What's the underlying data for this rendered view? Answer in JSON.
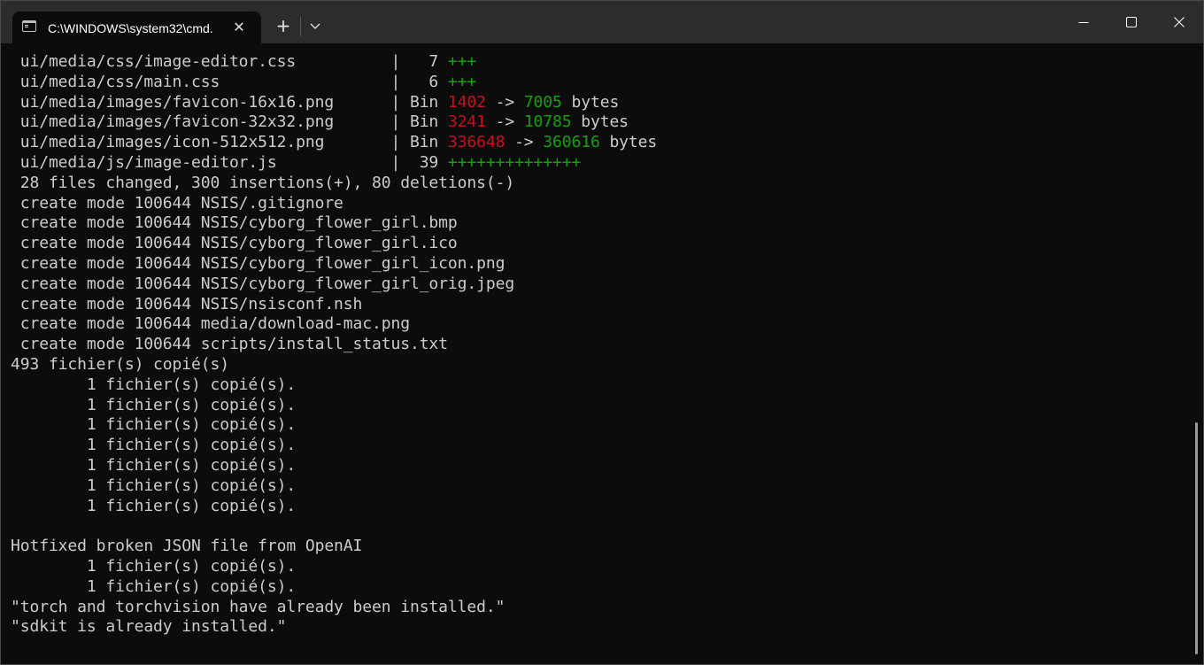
{
  "window": {
    "tab_title": "C:\\WINDOWS\\system32\\cmd.",
    "tab_close_glyph": "✕",
    "new_tab_glyph": "+"
  },
  "colors": {
    "background": "#0c0c0c",
    "titlebar": "#2c2c2c",
    "text": "#cccccc",
    "deletion_red": "#c50f1f",
    "insertion_green": "#13a10e"
  },
  "terminal": {
    "lines": [
      [
        {
          "t": " ui/media/css/image-editor.css          |   7 "
        },
        {
          "t": "+++",
          "c": "green"
        }
      ],
      [
        {
          "t": " ui/media/css/main.css                  |   6 "
        },
        {
          "t": "+++",
          "c": "green"
        }
      ],
      [
        {
          "t": " ui/media/images/favicon-16x16.png      | Bin "
        },
        {
          "t": "1402",
          "c": "red"
        },
        {
          "t": " -> "
        },
        {
          "t": "7005",
          "c": "green"
        },
        {
          "t": " bytes"
        }
      ],
      [
        {
          "t": " ui/media/images/favicon-32x32.png      | Bin "
        },
        {
          "t": "3241",
          "c": "red"
        },
        {
          "t": " -> "
        },
        {
          "t": "10785",
          "c": "green"
        },
        {
          "t": " bytes"
        }
      ],
      [
        {
          "t": " ui/media/images/icon-512x512.png       | Bin "
        },
        {
          "t": "336648",
          "c": "red"
        },
        {
          "t": " -> "
        },
        {
          "t": "360616",
          "c": "green"
        },
        {
          "t": " bytes"
        }
      ],
      [
        {
          "t": " ui/media/js/image-editor.js            |  39 "
        },
        {
          "t": "++++++++++++++",
          "c": "green"
        }
      ],
      [
        {
          "t": " 28 files changed, 300 insertions(+), 80 deletions(-)"
        }
      ],
      [
        {
          "t": " create mode 100644 NSIS/.gitignore"
        }
      ],
      [
        {
          "t": " create mode 100644 NSIS/cyborg_flower_girl.bmp"
        }
      ],
      [
        {
          "t": " create mode 100644 NSIS/cyborg_flower_girl.ico"
        }
      ],
      [
        {
          "t": " create mode 100644 NSIS/cyborg_flower_girl_icon.png"
        }
      ],
      [
        {
          "t": " create mode 100644 NSIS/cyborg_flower_girl_orig.jpeg"
        }
      ],
      [
        {
          "t": " create mode 100644 NSIS/nsisconf.nsh"
        }
      ],
      [
        {
          "t": " create mode 100644 media/download-mac.png"
        }
      ],
      [
        {
          "t": " create mode 100644 scripts/install_status.txt"
        }
      ],
      [
        {
          "t": "493 fichier(s) copié(s)"
        }
      ],
      [
        {
          "t": "        1 fichier(s) copié(s)."
        }
      ],
      [
        {
          "t": "        1 fichier(s) copié(s)."
        }
      ],
      [
        {
          "t": "        1 fichier(s) copié(s)."
        }
      ],
      [
        {
          "t": "        1 fichier(s) copié(s)."
        }
      ],
      [
        {
          "t": "        1 fichier(s) copié(s)."
        }
      ],
      [
        {
          "t": "        1 fichier(s) copié(s)."
        }
      ],
      [
        {
          "t": "        1 fichier(s) copié(s)."
        }
      ],
      [],
      [
        {
          "t": "Hotfixed broken JSON file from OpenAI"
        }
      ],
      [
        {
          "t": "        1 fichier(s) copié(s)."
        }
      ],
      [
        {
          "t": "        1 fichier(s) copié(s)."
        }
      ],
      [
        {
          "t": "\"torch and torchvision have already been installed.\""
        }
      ],
      [
        {
          "t": "\"sdkit is already installed.\""
        }
      ]
    ]
  }
}
